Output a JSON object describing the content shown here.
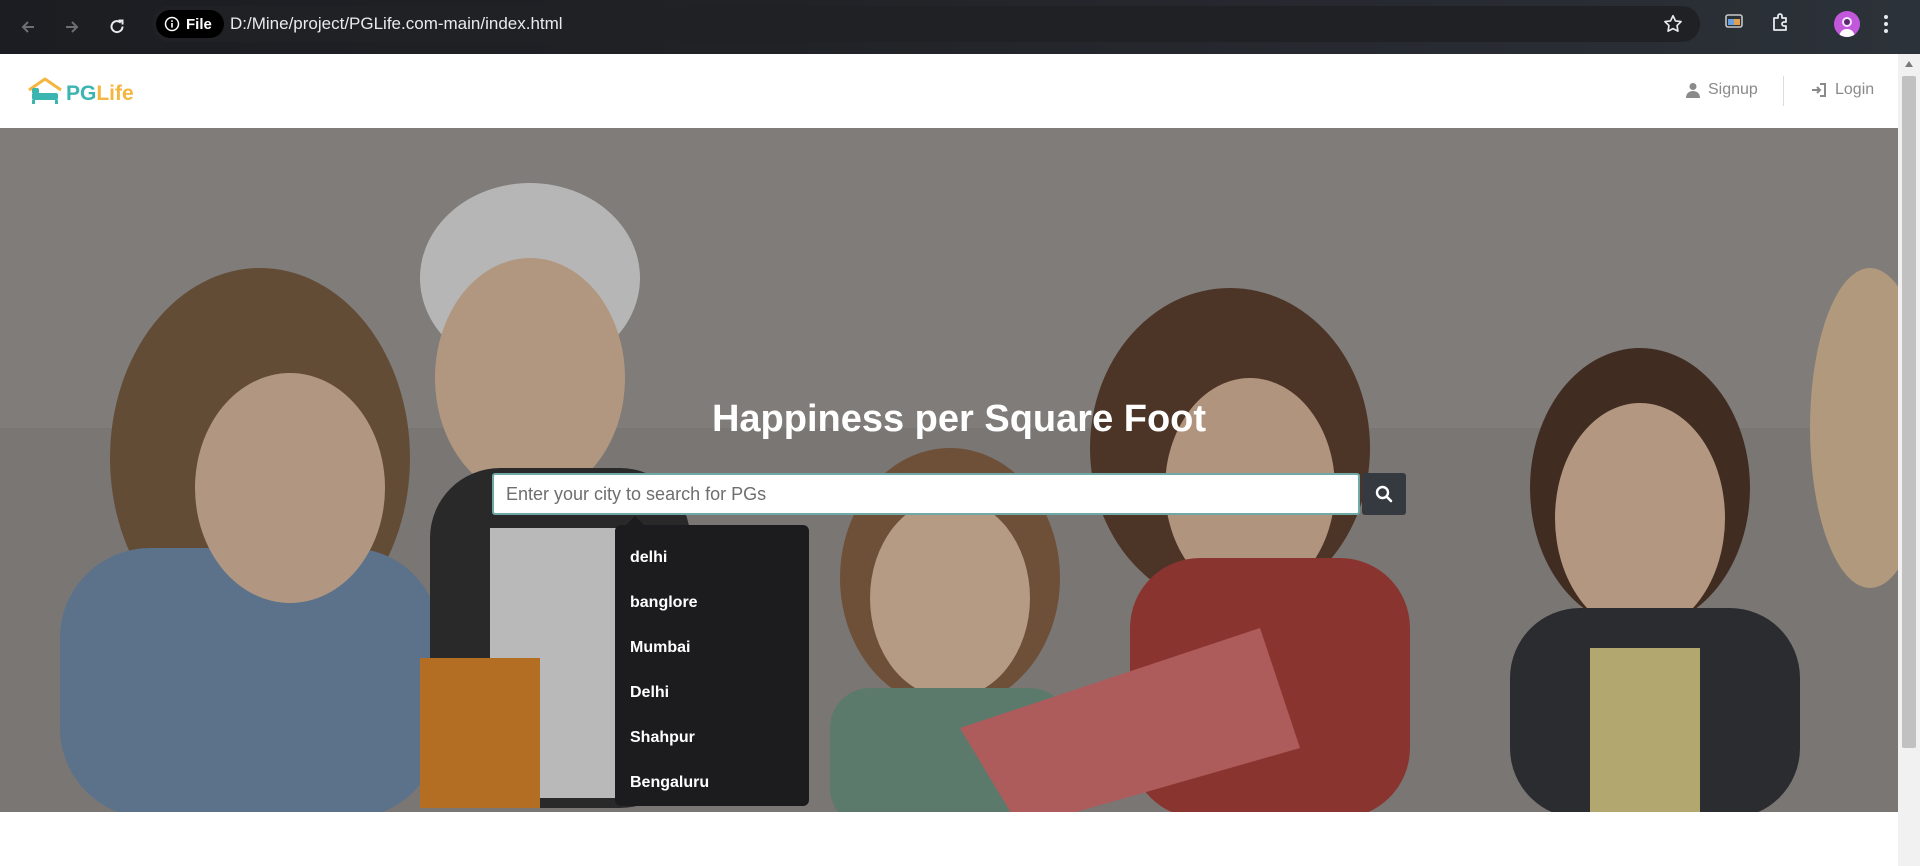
{
  "browser": {
    "file_chip_label": "File",
    "url": "D:/Mine/project/PGLife.com-main/index.html",
    "icons": [
      "back-arrow-icon",
      "forward-arrow-icon",
      "reload-icon",
      "info-icon",
      "star-icon",
      "cast-icon",
      "extensions-icon",
      "profile-avatar",
      "more-menu-icon"
    ]
  },
  "header": {
    "logo_pg": "PG",
    "logo_life": "Life",
    "signup_label": "Signup",
    "login_label": "Login"
  },
  "hero": {
    "title": "Happiness per Square Foot",
    "search_placeholder": "Enter your city to search for PGs",
    "search_icon": "search-icon"
  },
  "dropdown": {
    "items": [
      "delhi",
      "banglore",
      "Mumbai",
      "Delhi",
      "Shahpur",
      "Bengaluru"
    ]
  },
  "colors": {
    "brand_teal": "#3ab5b0",
    "brand_yellow": "#f4b63f",
    "search_button": "#343a40",
    "dropdown_bg": "#1c1c1e"
  }
}
